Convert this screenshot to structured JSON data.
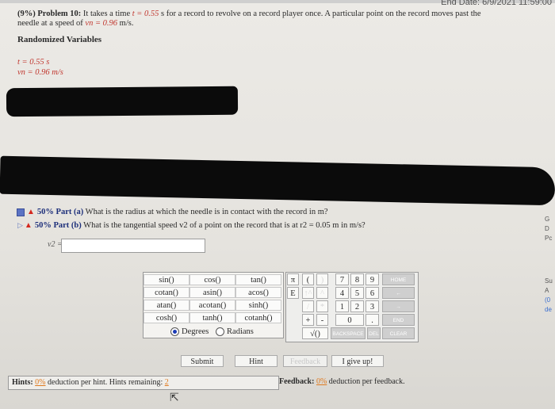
{
  "header": {
    "end_date": "End Date: 6/9/2021 11:59:00"
  },
  "problem": {
    "prefix": "(9%) Problem 10:",
    "text1": "It takes a time ",
    "t_var": "t = 0.55",
    "text2": " s for a record to revolve on a record player once. A particular point on the record moves past the",
    "text3": "needle at a speed of ",
    "v_var": "vn = 0.96",
    "text4": " m/s."
  },
  "random_vars": {
    "title": "Randomized Variables",
    "t_line": "t = 0.55 s",
    "v_line": "vn = 0.96 m/s"
  },
  "parts": {
    "a": {
      "pct": "50% Part (a)",
      "text": "What is the radius at which the needle is in contact with the record in m?"
    },
    "b": {
      "pct": "50% Part (b)",
      "text": "What is the tangential speed v2 of a point on the record that is at r2 = 0.05 m in m/s?"
    }
  },
  "answer": {
    "label": "v2 =",
    "value": ""
  },
  "calculator": {
    "funcs": [
      [
        "sin()",
        "cos()",
        "tan()"
      ],
      [
        "cotan()",
        "asin()",
        "acos()"
      ],
      [
        "atan()",
        "acotan()",
        "sinh()"
      ],
      [
        "cosh()",
        "tanh()",
        "cotanh()"
      ]
    ],
    "degrees": "Degrees",
    "radians": "Radians",
    "keys": {
      "pi": "π",
      "lparen": "(",
      "rparen": ")",
      "e": "E",
      "up": "↑^",
      "caret": "^",
      "k7": "7",
      "k8": "8",
      "k9": "9",
      "home": "HOME",
      "k4": "4",
      "k5": "5",
      "k6": "6",
      "left": "←",
      "div": "/",
      "mul": "*",
      "k1": "1",
      "k2": "2",
      "k3": "3",
      "right": "→",
      "plus": "+",
      "minus": "-",
      "k0": "0",
      "dot": ".",
      "end": "END",
      "sqrt": "√()",
      "backspace": "BACKSPACE",
      "del": "DEL",
      "clear": "CLEAR"
    }
  },
  "buttons": {
    "submit": "Submit",
    "hint": "Hint",
    "feedback": "Feedback",
    "giveup": "I give up!"
  },
  "hints": {
    "label": "Hints:",
    "pct": "0%",
    "text": "deduction per hint. Hints remaining:",
    "remaining": "2"
  },
  "feedback": {
    "label": "Feedback:",
    "pct": "0%",
    "text": "deduction per feedback."
  },
  "side": {
    "a": "G",
    "b": "D",
    "c": "Pc",
    "d": "Su",
    "e": "A",
    "f": "(0",
    "g": "de"
  }
}
